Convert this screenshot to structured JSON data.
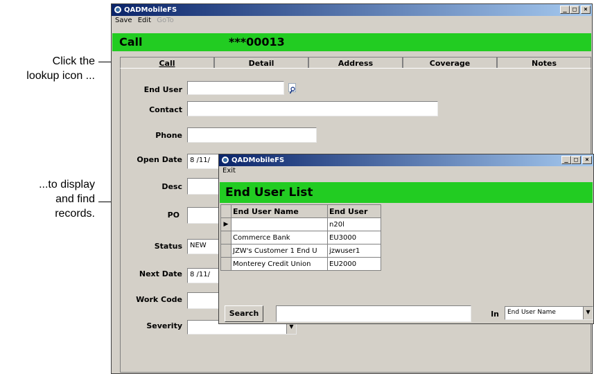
{
  "annotations": {
    "lookup_line1": "Click the",
    "lookup_line2": "lookup icon ...",
    "display_line1": "...to display",
    "display_line2": "and find",
    "display_line3": "records."
  },
  "main_window": {
    "title": "QADMobileFS",
    "menu": {
      "save": "Save",
      "edit": "Edit",
      "goto": "GoTo"
    },
    "header_label": "Call",
    "header_number": "***00013",
    "tabs": [
      "Call",
      "Detail",
      "Address",
      "Coverage",
      "Notes"
    ],
    "fields": {
      "end_user": {
        "label": "End User",
        "value": ""
      },
      "contact": {
        "label": "Contact",
        "value": ""
      },
      "phone": {
        "label": "Phone",
        "value": ""
      },
      "open_date": {
        "label": "Open Date",
        "value": "8 /11/"
      },
      "desc": {
        "label": "Desc",
        "value": ""
      },
      "po": {
        "label": "PO",
        "value": ""
      },
      "status": {
        "label": "Status",
        "value": "NEW"
      },
      "next_date": {
        "label": "Next Date",
        "value": "8 /11/"
      },
      "work_code": {
        "label": "Work Code",
        "value": ""
      },
      "severity": {
        "label": "Severity",
        "value": ""
      }
    }
  },
  "popup": {
    "title": "QADMobileFS",
    "menu_exit": "Exit",
    "header": "End User List",
    "columns": [
      "End User Name",
      "End User"
    ],
    "rows": [
      {
        "name": "",
        "code": "n20l",
        "current": true
      },
      {
        "name": "Commerce Bank",
        "code": "EU3000"
      },
      {
        "name": "JZW's Customer 1 End U",
        "code": "jzwuser1"
      },
      {
        "name": "Monterey Credit Union",
        "code": "EU2000"
      }
    ],
    "search_label": "Search",
    "search_value": "",
    "in_label": "In",
    "in_selected": "End User Name"
  }
}
